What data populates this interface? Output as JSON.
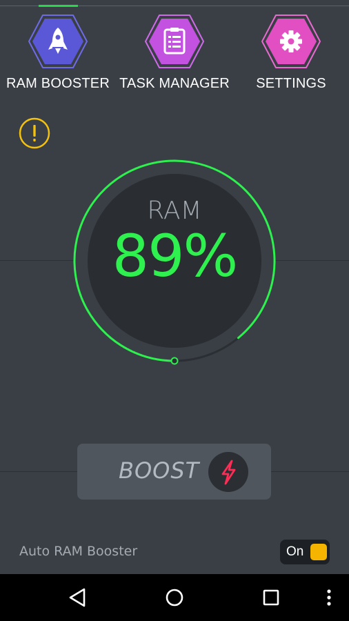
{
  "nav": {
    "items": [
      {
        "label": "RAM BOOSTER",
        "icon": "rocket-icon",
        "color": "#5b58d8"
      },
      {
        "label": "TASK MANAGER",
        "icon": "clipboard-list-icon",
        "color": "#c452e0"
      },
      {
        "label": "SETTINGS",
        "icon": "gear-icon",
        "color": "#e24fc2"
      }
    ]
  },
  "alert": {
    "icon": "warning-icon",
    "color": "#f4c20d"
  },
  "gauge": {
    "label": "RAM",
    "value_text": "89%",
    "percent": 89,
    "accent_color": "#2ef04e"
  },
  "boost": {
    "label": "BOOST",
    "icon": "lightning-bolt-icon",
    "icon_color": "#ff2d55"
  },
  "auto_booster": {
    "label": "Auto RAM Booster",
    "toggle_text": "On",
    "toggle_color": "#f4b400"
  },
  "system_nav": {
    "buttons": [
      "back-icon",
      "home-icon",
      "recent-apps-icon",
      "more-vert-icon"
    ]
  }
}
